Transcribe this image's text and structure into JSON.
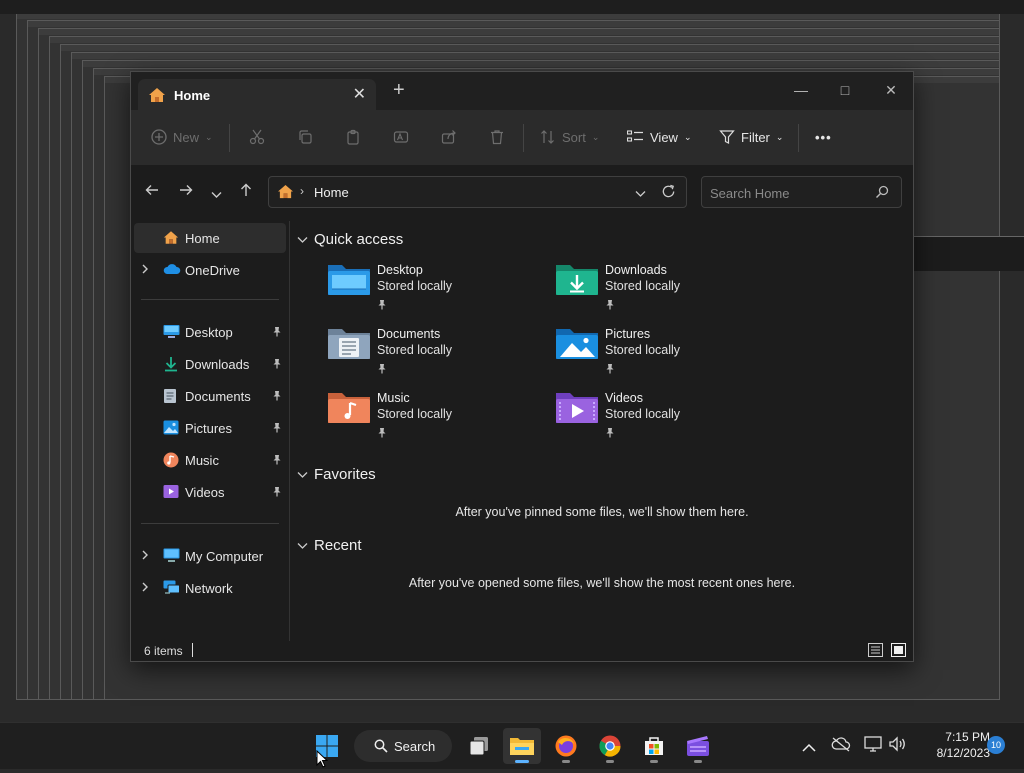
{
  "window": {
    "tab_title": "Home",
    "new_tab_symbol": "+",
    "controls": {
      "minimize": "—",
      "maximize": "□",
      "close": "✕"
    }
  },
  "toolbar": {
    "new_label": "New",
    "sort_label": "Sort",
    "view_label": "View",
    "filter_label": "Filter",
    "more_label": "•••"
  },
  "address": {
    "breadcrumb": "Home",
    "separator": "›"
  },
  "search": {
    "placeholder": "Search Home"
  },
  "sidebar": {
    "items": [
      {
        "label": "Home",
        "icon": "home-icon",
        "selected": true
      },
      {
        "label": "OneDrive",
        "icon": "cloud-icon",
        "expandable": true
      },
      {
        "label": "Desktop",
        "icon": "desktop-folder-icon",
        "pinned": true
      },
      {
        "label": "Downloads",
        "icon": "download-icon",
        "pinned": true
      },
      {
        "label": "Documents",
        "icon": "documents-icon",
        "pinned": true
      },
      {
        "label": "Pictures",
        "icon": "pictures-icon",
        "pinned": true
      },
      {
        "label": "Music",
        "icon": "music-icon",
        "pinned": true
      },
      {
        "label": "Videos",
        "icon": "videos-icon",
        "pinned": true
      },
      {
        "label": "My Computer",
        "icon": "computer-icon",
        "expandable": true
      },
      {
        "label": "Network",
        "icon": "network-icon",
        "expandable": true
      }
    ]
  },
  "sections": {
    "quick_access": "Quick access",
    "favorites": "Favorites",
    "recent": "Recent"
  },
  "quick_access": [
    {
      "name": "Desktop",
      "sub": "Stored locally",
      "icon": "desktop-folder-icon",
      "color": "#2b9ae8"
    },
    {
      "name": "Downloads",
      "sub": "Stored locally",
      "icon": "downloads-folder-icon",
      "color": "#1fb58f"
    },
    {
      "name": "Documents",
      "sub": "Stored locally",
      "icon": "documents-folder-icon",
      "color": "#8fa5bd"
    },
    {
      "name": "Pictures",
      "sub": "Stored locally",
      "icon": "pictures-folder-icon",
      "color": "#1a8fe0"
    },
    {
      "name": "Music",
      "sub": "Stored locally",
      "icon": "music-folder-icon",
      "color": "#f0855c"
    },
    {
      "name": "Videos",
      "sub": "Stored locally",
      "icon": "videos-folder-icon",
      "color": "#9a63e0"
    }
  ],
  "messages": {
    "favorites_empty": "After you've pinned some files, we'll show them here.",
    "recent_empty": "After you've opened some files, we'll show the most recent ones here."
  },
  "status": {
    "item_count": "6 items"
  },
  "taskbar": {
    "search_label": "Search",
    "apps": [
      "start-icon",
      "task-view-icon",
      "file-explorer-icon",
      "firefox-icon",
      "chrome-icon",
      "store-icon",
      "clipchamp-icon"
    ],
    "time": "7:15 PM",
    "date": "8/12/2023",
    "notifications": "10"
  },
  "colors": {
    "accent": "#5db3ff",
    "window_bg": "#1c1c1c",
    "toolbar_bg": "#2b2b2b"
  }
}
